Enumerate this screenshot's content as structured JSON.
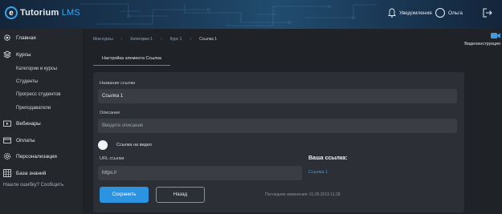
{
  "header": {
    "logo_text": "Tutorium",
    "logo_suffix": " LMS",
    "notifications_label": "Уведомления",
    "user_name": "Ольга"
  },
  "sidebar": {
    "items": [
      {
        "label": "Главная",
        "icon": "gear-icon"
      },
      {
        "label": "Курсы",
        "icon": "layers-icon"
      },
      {
        "label": "Вебинары",
        "icon": "video-icon"
      },
      {
        "label": "Оплаты",
        "icon": "wallet-icon"
      },
      {
        "label": "Персонализация",
        "icon": "settings-icon"
      },
      {
        "label": "База знаний",
        "icon": "grid-icon"
      }
    ],
    "sub_items": [
      "Категории и курсы",
      "Студенты",
      "Прогресс студентов",
      "Преподаватели"
    ],
    "error_link": "Нашли ошибку? Сообщить"
  },
  "breadcrumb": [
    "Мои курсы",
    "Категория 1",
    "Курс 1",
    "Ссылка 1"
  ],
  "video_help_label": "Видеоинструкция",
  "tab_label": "Настройка элемента Ссылка",
  "form": {
    "name_label": "Название ссылки",
    "name_value": "Ссылка 1",
    "desc_label": "Описание",
    "desc_placeholder": "Введите описание",
    "toggle_label": "Ссылка на видео",
    "url_label": "URL ссылки",
    "url_value": "https://",
    "your_link_title": "Ваша ссылка:",
    "your_link_value": "Ссылка 1",
    "save_label": "Сохранить",
    "back_label": "Назад",
    "last_changed": "Последние изменения: 01.05.2019 11:28"
  },
  "colors": {
    "accent": "#2c93e0",
    "background": "#1f2227",
    "card": "#2c2f35"
  }
}
